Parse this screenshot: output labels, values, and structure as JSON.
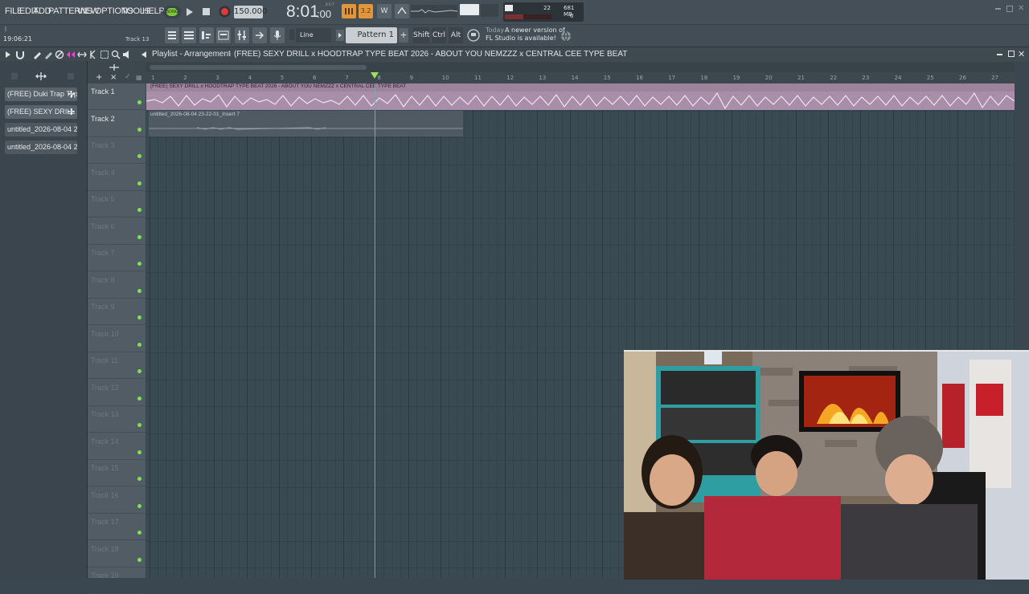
{
  "menu": [
    "FILE",
    "EDIT",
    "ADD",
    "PATTERNS",
    "VIEW",
    "OPTIONS",
    "TOOLS",
    "HELP"
  ],
  "transport": {
    "mode": "SONG",
    "tempo": "150.000",
    "time": "8:01",
    "time_sub": ":00",
    "time_unit": "B:S:T",
    "cpu": "22",
    "ram": "681 MB",
    "poly": "0"
  },
  "hint": {
    "time": "19:06:21",
    "track": "Track 13"
  },
  "toolbar": {
    "snap": "Line",
    "pattern": "Pattern 1",
    "shift": "Shift",
    "ctrl": "Ctrl",
    "alt": "Alt",
    "news_day": "Today",
    "news_text1": "A newer version of",
    "news_text2": "FL Studio is available!"
  },
  "playlist": {
    "title": "Playlist - Arrangement",
    "crumb": "(FREE) SEXY DRILL x HOODTRAP TYPE BEAT 2026 - ABOUT YOU  NEMZZZ x CENTRAL CEE TYPE BEAT"
  },
  "browser": {
    "items": [
      "(FREE) Duki Trap Typ...",
      "(FREE) SEXY DRILL x...",
      "untitled_2026-08-04 23-...",
      "untitled_2026-08-04 23-..."
    ]
  },
  "tracks": [
    "Track 1",
    "Track 2",
    "Track 3",
    "Track 4",
    "Track 5",
    "Track 6",
    "Track 7",
    "Track 8",
    "Track 9",
    "Track 10",
    "Track 11",
    "Track 12",
    "Track 13",
    "Track 14",
    "Track 15",
    "Track 16",
    "Track 17",
    "Track 18",
    "Track 19"
  ],
  "ruler": [
    "1",
    "2",
    "3",
    "4",
    "5",
    "6",
    "7",
    "8",
    "9",
    "10",
    "11",
    "12",
    "13",
    "14",
    "15",
    "16",
    "17",
    "18",
    "19",
    "20",
    "21",
    "22",
    "23",
    "24",
    "25",
    "26",
    "27"
  ],
  "clips": {
    "clip1": "(FREE) SEXY DRILL x HOODTRAP TYPE BEAT 2026 - ABOUT YOU  NEMZZZ x CENTRAL CEE TYPE BEAT",
    "clip2": "untitled_2026-08-04 23-22-01_Insert 7"
  },
  "colors": {
    "accent_green": "#7ee34a",
    "clip1": "#b59ab4",
    "clip2": "#4f5a63",
    "record": "#e0393b",
    "song_mode": "#7ec63a"
  }
}
